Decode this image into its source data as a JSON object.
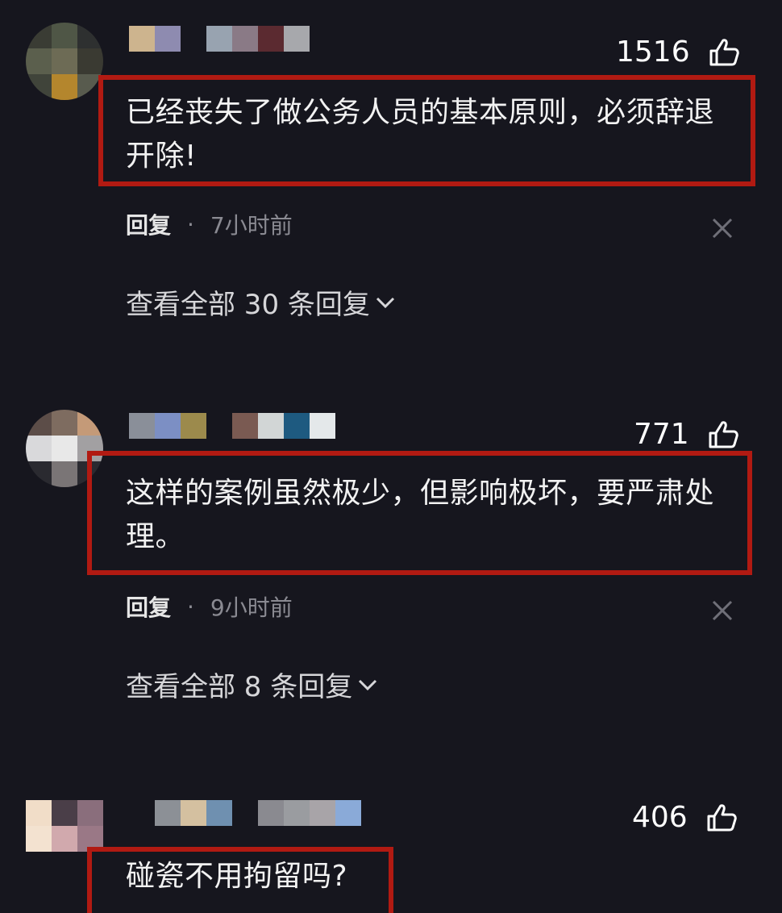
{
  "comments": [
    {
      "likes": "1516",
      "text": "已经丧失了做公务人员的基本原则，必须辞退\n开除!",
      "reply_label": "回复",
      "separator": "·",
      "time": "7小时前",
      "view_replies": "查看全部 30 条回复",
      "avatar_colors": [
        "#3a3c34",
        "#4f5646",
        "#2e3030",
        "#5b5f4d",
        "#6d6b55",
        "#3a3a32",
        "#40443a",
        "#b4862d",
        "#585b4e"
      ],
      "name_colors": [
        "#cdb48e",
        "#8e8bb0",
        "#98a3b0",
        "#8a7a86",
        "#5b2a30",
        "#a7a8ac"
      ]
    },
    {
      "likes": "771",
      "text": "这样的案例虽然极少，但影响极坏，要严肃处\n理。",
      "reply_label": "回复",
      "separator": "·",
      "time": "9小时前",
      "view_replies": "查看全部 8 条回复",
      "avatar_colors": [
        "#5c4d48",
        "#7e6c60",
        "#c49a78",
        "#d9d9db",
        "#e8e8e8",
        "#a2a0a2",
        "#2a2a30",
        "#7a7576",
        "#2a2a30"
      ],
      "name_colors": [
        "#8a8f99",
        "#7c8fc4",
        "#9c8a4c",
        "#7a5a52",
        "#d2d6d6",
        "#1e5a80",
        "#e4e8ea"
      ]
    },
    {
      "likes": "406",
      "text": "碰瓷不用拘留吗?",
      "avatar_colors": [
        "#f1ddc8",
        "#4a3e48",
        "#8a6e7c",
        "#f3e2d0",
        "#d1a9ad",
        "#9a7886"
      ],
      "name_colors": [
        "#8c9096",
        "#d4c0a0",
        "#6f90b0",
        "#8a8a90",
        "#9a9ca0",
        "#a8a4a8",
        "#8aaad8"
      ]
    }
  ]
}
